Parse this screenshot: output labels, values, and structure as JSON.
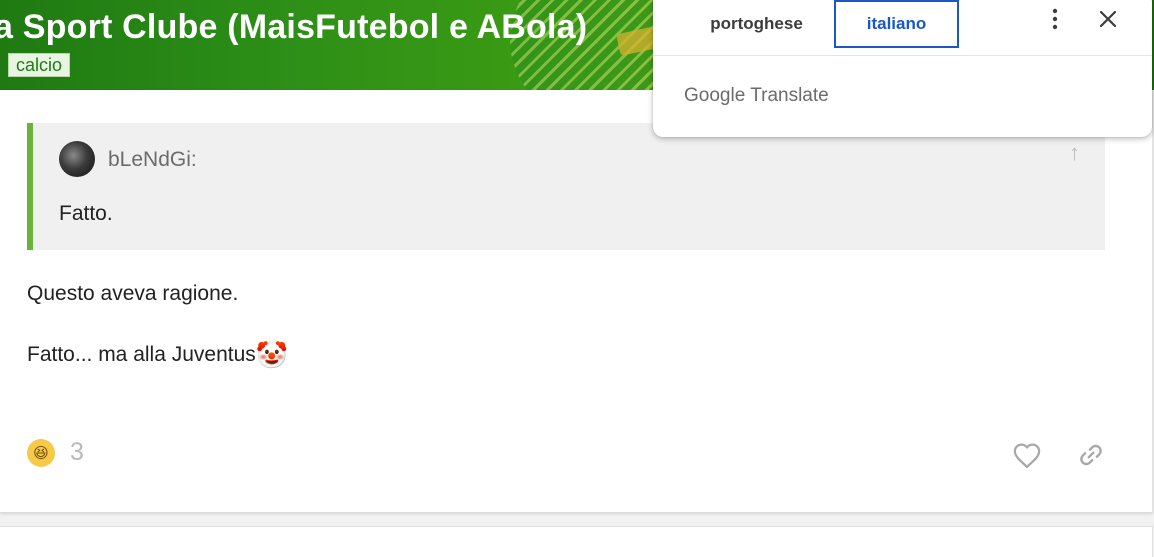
{
  "banner": {
    "title": "a Sport Clube (MaisFutebol e ABola)",
    "category": "calcio",
    "colors": {
      "primary": "#2d8f17",
      "tag_text": "#1d7e12"
    }
  },
  "post": {
    "quote": {
      "author": "bLeNdGi:",
      "text": "Fatto.",
      "accent_color": "#68b33a",
      "icons": {
        "avatar": "user-avatar",
        "jump": "arrow-up-icon"
      }
    },
    "paragraphs": [
      {
        "text": "Questo aveva ragione."
      },
      {
        "text": "Fatto... ma alla Juventus",
        "emoji": "🤡"
      }
    ],
    "reaction": {
      "emoji": "laughing-emoji-icon",
      "glyph": "😆",
      "count": "3"
    },
    "actions": {
      "like": "heart-icon",
      "share": "link-icon"
    }
  },
  "translate_popup": {
    "tabs": [
      {
        "label": "portoghese",
        "active": false
      },
      {
        "label": "italiano",
        "active": true
      }
    ],
    "brand_google": "Google",
    "brand_translate": "Translate",
    "icons": {
      "more": "more-vert-icon",
      "close": "close-icon"
    },
    "accent_color": "#1a57c8"
  }
}
